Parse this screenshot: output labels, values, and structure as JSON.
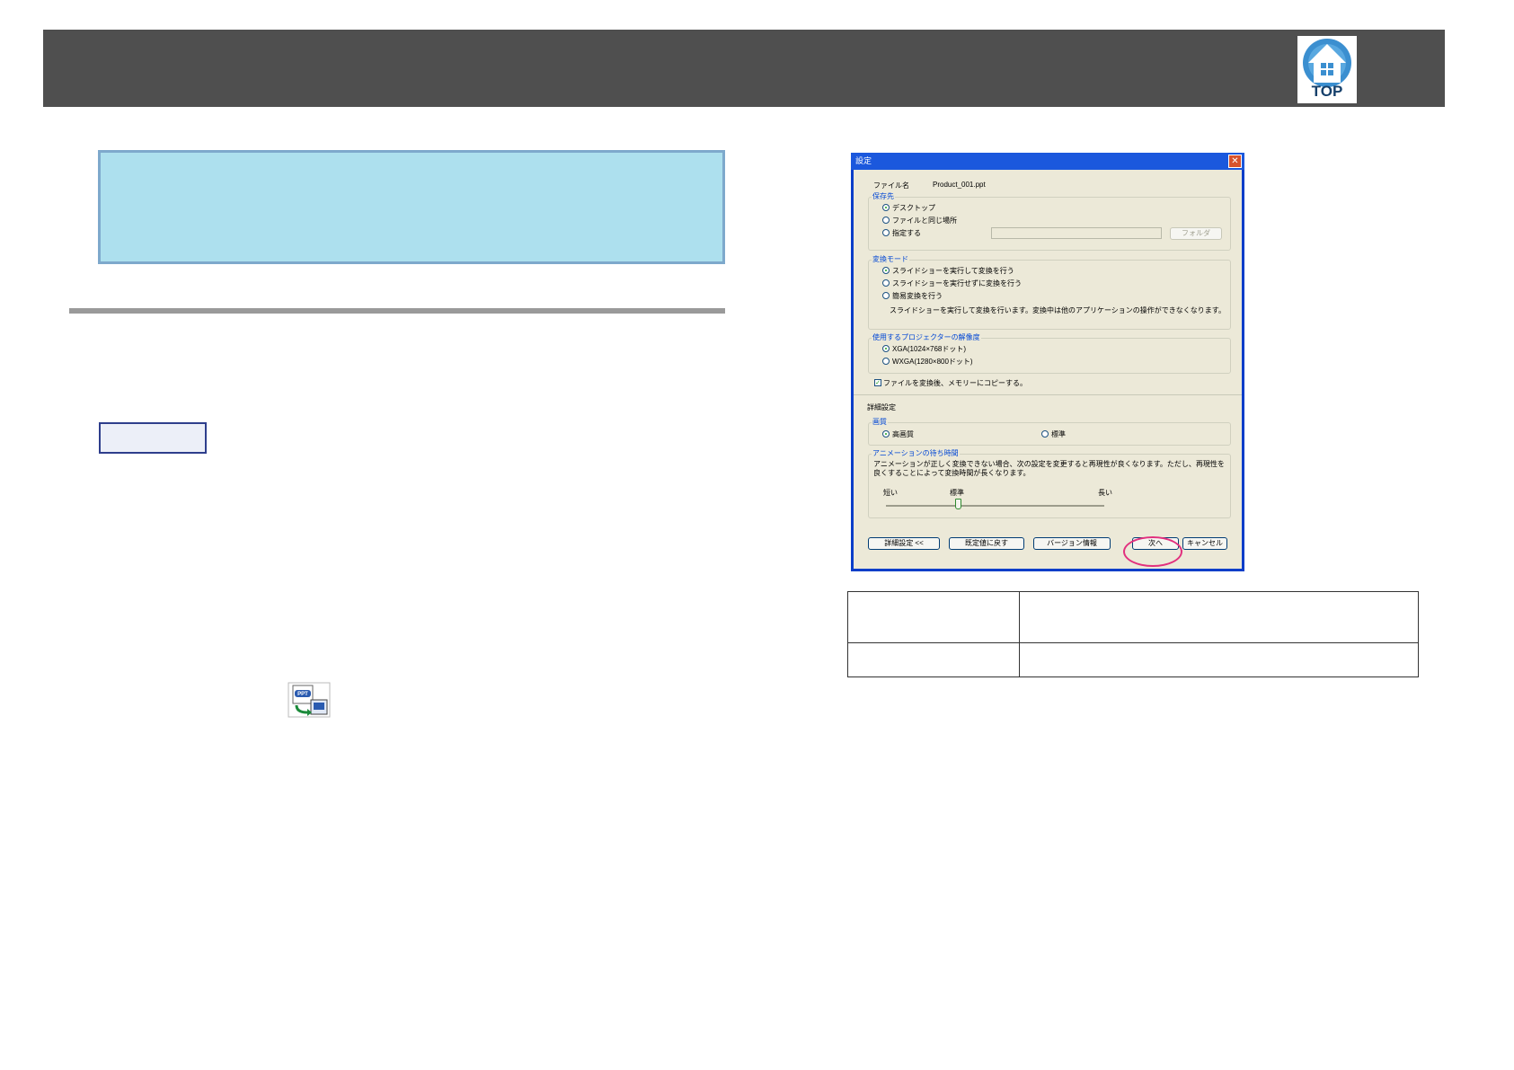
{
  "header": {
    "top_button_label": "TOP",
    "top_icon": "home-house-icon"
  },
  "dialog": {
    "title": "設定",
    "filename_label": "ファイル名",
    "filename_value": "Product_001.ppt",
    "save_to": {
      "label": "保存先",
      "options": [
        "デスクトップ",
        "ファイルと同じ場所",
        "指定する"
      ],
      "selected": 0,
      "path_value": "",
      "folder_button": "フォルダ"
    },
    "convert_mode": {
      "label": "変換モード",
      "options": [
        "スライドショーを実行して変換を行う",
        "スライドショーを実行せずに変換を行う",
        "簡易変換を行う"
      ],
      "selected": 0,
      "note": "スライドショーを実行して変換を行います。変換中は他のアプリケーションの操作ができなくなります。"
    },
    "resolution": {
      "label": "使用するプロジェクターの解像度",
      "options": [
        "XGA(1024×768ドット)",
        "WXGA(1280×800ドット)"
      ],
      "selected": 0
    },
    "copy_checkbox_label": "ファイルを変換後、メモリーにコピーする。",
    "copy_checked": true,
    "advanced": {
      "heading": "詳細設定",
      "quality_label": "画質",
      "quality_options": [
        "高画質",
        "標準"
      ],
      "quality_selected": 0,
      "wait_label": "アニメーションの待ち時間",
      "wait_note_line1": "アニメーションが正しく変換できない場合、次の設定を変更すると再現性が良くなります。ただし、再現性を",
      "wait_note_line2": "良くすることによって変換時間が長くなります。",
      "slider_min_label": "短い",
      "slider_mid_label": "標準",
      "slider_max_label": "長い",
      "slider_level": 0.33
    },
    "buttons": {
      "advanced": "詳細設定 <<",
      "defaults": "既定値に戻す",
      "version": "バージョン情報",
      "next": "次へ",
      "cancel": "キャンセル"
    }
  },
  "procedure_label": ""
}
